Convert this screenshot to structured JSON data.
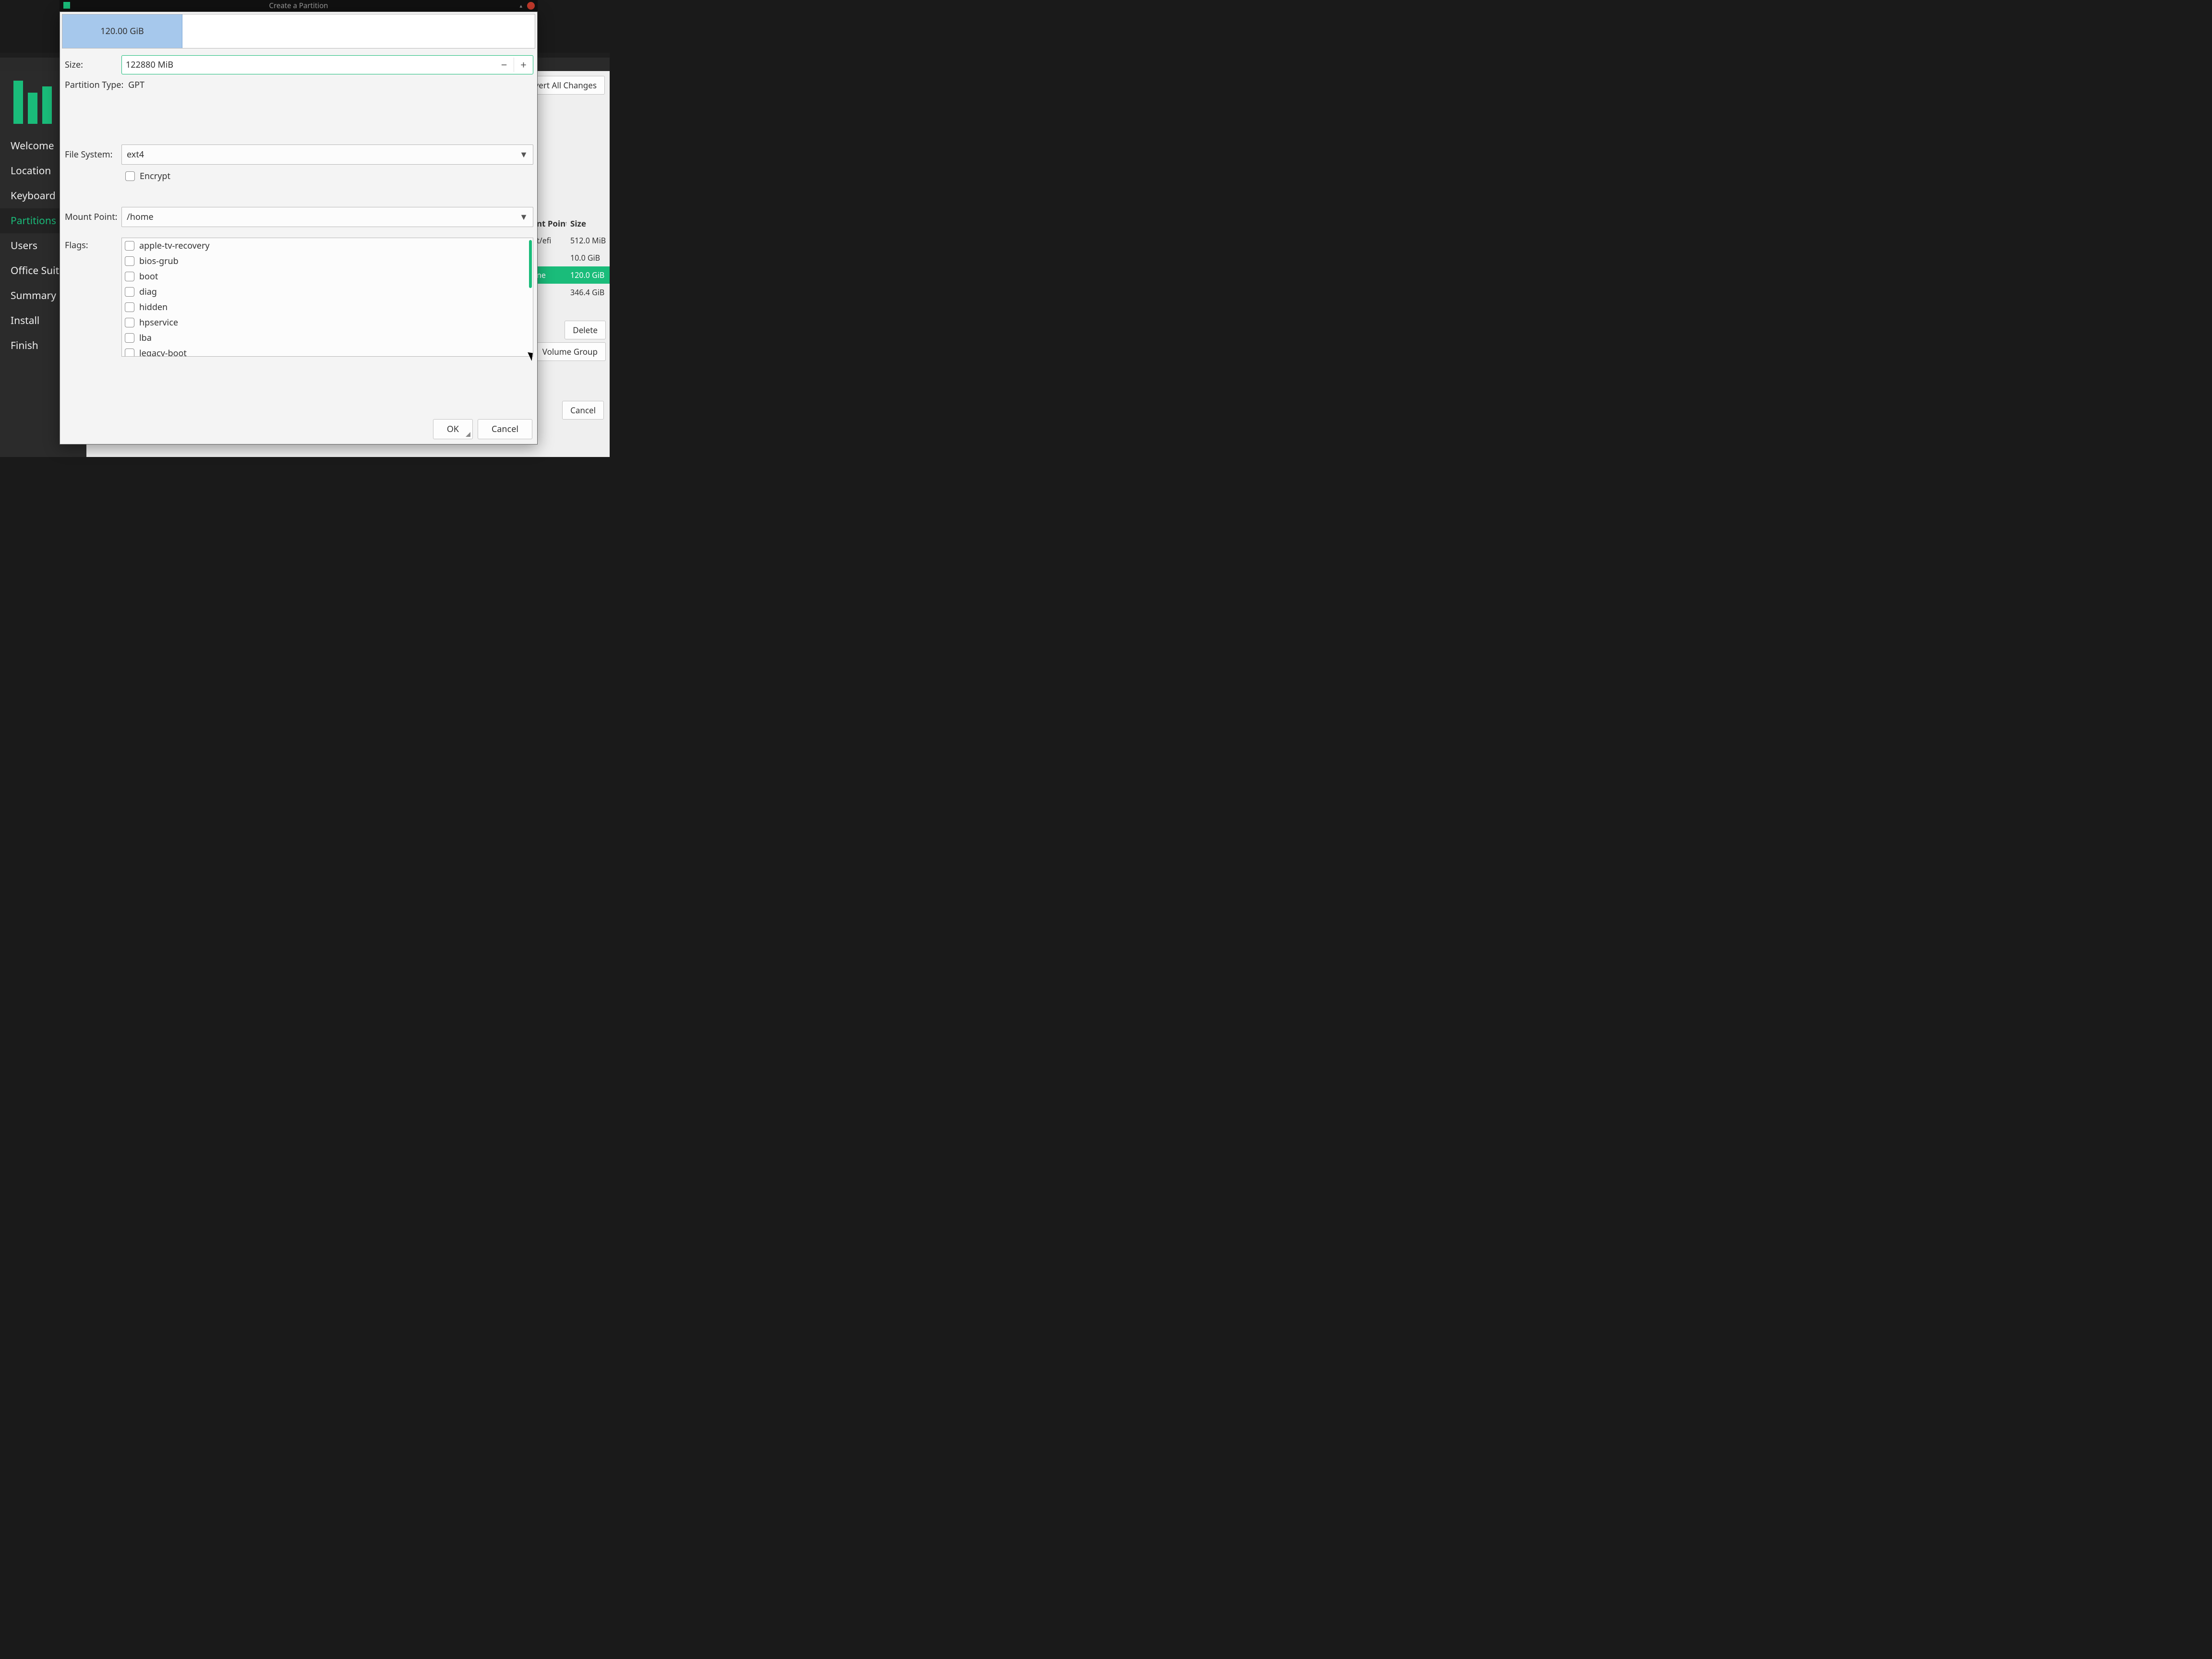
{
  "dialog": {
    "title": "Create a Partition",
    "size_display": "120.00 GiB",
    "labels": {
      "size": "Size:",
      "partition_type": "Partition Type:",
      "file_system": "File System:",
      "encrypt": "Encrypt",
      "mount_point": "Mount Point:",
      "flags": "Flags:"
    },
    "size_value": "122880 MiB",
    "partition_type_value": "GPT",
    "file_system_value": "ext4",
    "encrypt_checked": false,
    "mount_point_value": "/home",
    "flags": [
      "apple-tv-recovery",
      "bios-grub",
      "boot",
      "diag",
      "hidden",
      "hpservice",
      "lba",
      "legacy-boot"
    ],
    "buttons": {
      "ok": "OK",
      "cancel": "Cancel"
    }
  },
  "installer": {
    "nav": [
      {
        "label": "Welcome",
        "active": false
      },
      {
        "label": "Location",
        "active": false
      },
      {
        "label": "Keyboard",
        "active": false
      },
      {
        "label": "Partitions",
        "active": true
      },
      {
        "label": "Users",
        "active": false
      },
      {
        "label": "Office Suite",
        "active": false
      },
      {
        "label": "Summary",
        "active": false
      },
      {
        "label": "Install",
        "active": false
      },
      {
        "label": "Finish",
        "active": false
      }
    ],
    "toolbar": {
      "revert": "Revert All Changes"
    },
    "table": {
      "headers": {
        "mount": "nt Point",
        "size": "Size"
      },
      "rows": [
        {
          "mount": "t/efi",
          "size": "512.0 MiB",
          "selected": false
        },
        {
          "mount": "",
          "size": "10.0 GiB",
          "selected": false
        },
        {
          "mount": "ne",
          "size": "120.0 GiB",
          "selected": true
        },
        {
          "mount": "",
          "size": "346.4 GiB",
          "selected": false
        }
      ]
    },
    "buttons": {
      "delete": "Delete",
      "volume_group": "Volume Group",
      "cancel": "Cancel"
    }
  }
}
